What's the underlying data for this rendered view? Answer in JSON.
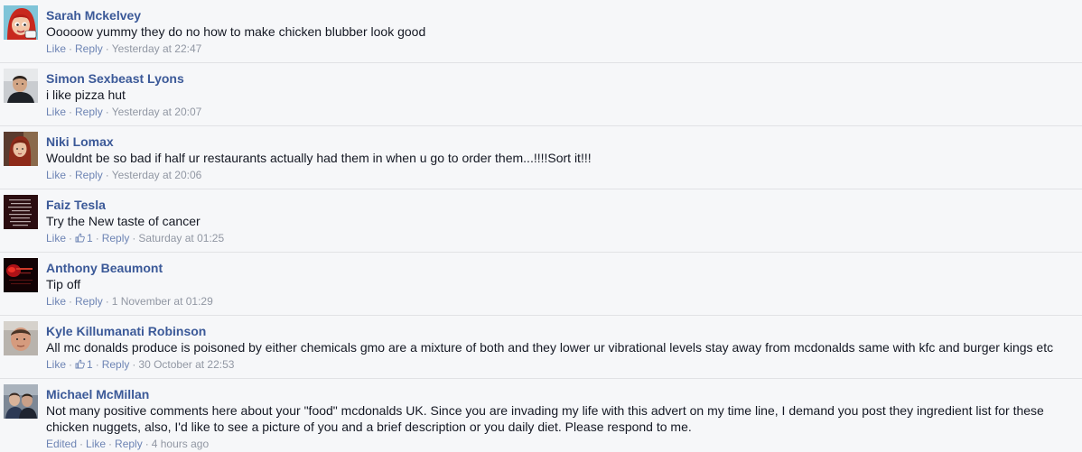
{
  "comments": [
    {
      "author": "Sarah Mckelvey",
      "text": "Ooooow yummy they do no how to make chicken blubber look good",
      "like_label": "Like",
      "reply_label": "Reply",
      "time": "Yesterday at 22:47",
      "avatar": "cartoon-red-hair-avatar"
    },
    {
      "author": "Simon Sexbeast Lyons",
      "text": "i like pizza hut",
      "like_label": "Like",
      "reply_label": "Reply",
      "time": "Yesterday at 20:07",
      "avatar": "man-portrait-avatar"
    },
    {
      "author": "Niki Lomax",
      "text": "Wouldnt be so bad if half ur restaurants actually had them in when u go to order them...!!!!Sort it!!!",
      "like_label": "Like",
      "reply_label": "Reply",
      "time": "Yesterday at 20:06",
      "avatar": "woman-red-hair-avatar"
    },
    {
      "author": "Faiz Tesla",
      "text": "Try the New taste of cancer",
      "like_label": "Like",
      "like_count": "1",
      "reply_label": "Reply",
      "time": "Saturday at 01:25",
      "avatar": "dark-text-image-avatar"
    },
    {
      "author": "Anthony Beaumont",
      "text": "Tip off",
      "like_label": "Like",
      "reply_label": "Reply",
      "time": "1 November at 01:29",
      "avatar": "dark-red-graphic-avatar"
    },
    {
      "author": "Kyle Killumanati Robinson",
      "text": "All mc donalds produce is poisoned by either chemicals gmo are a mixture of both and they lower ur vibrational levels stay away from mcdonalds same with kfc and burger kings etc",
      "like_label": "Like",
      "like_count": "1",
      "reply_label": "Reply",
      "time": "30 October at 22:53",
      "avatar": "man-face-avatar"
    },
    {
      "author": "Michael McMillan",
      "text": "Not many positive comments here about your \"food\" mcdonalds UK. Since you are invading my life with this advert on my time line, I demand you post they ingredient list for these chicken nuggets, also, I'd like to see a picture of you and a brief description or you daily diet. Please respond to me.",
      "edited_label": "Edited",
      "like_label": "Like",
      "reply_label": "Reply",
      "time": "4 hours ago",
      "avatar": "man-group-photo-avatar"
    }
  ]
}
